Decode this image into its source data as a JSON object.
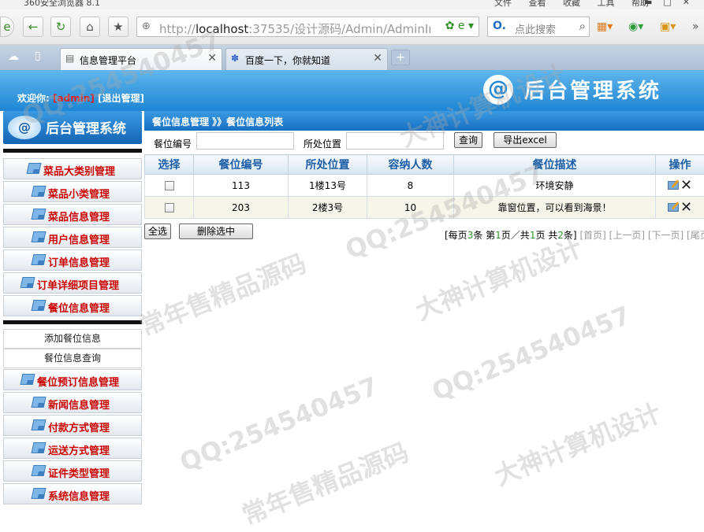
{
  "browser": {
    "app_title": "360安全浏览器 8.1",
    "menus": [
      "文件",
      "查看",
      "收藏",
      "工具",
      "帮助"
    ],
    "url_host": "localhost",
    "url_rest": ":37535/设计源码/Admin/AdminIı",
    "search_placeholder": "点此搜索",
    "tabs": [
      {
        "label": "信息管理平台",
        "active": true
      },
      {
        "label": "百度一下，你就知道",
        "active": false
      }
    ],
    "new_tab": "+"
  },
  "header": {
    "welcome_prefix": "欢迎你:",
    "username": "[admin]",
    "logout": "[退出管理]",
    "system_name": "后台管理系统",
    "logo_mark": "@"
  },
  "sidebar": {
    "logo_text": "后台管理系统",
    "items_top": [
      "菜品大类别管理",
      "菜品小类管理",
      "菜品信息管理",
      "用户信息管理",
      "订单信息管理",
      "订单详细项目管理",
      "餐位信息管理"
    ],
    "submenu": [
      "添加餐位信息",
      "餐位信息查询"
    ],
    "items_bottom": [
      "餐位预订信息管理",
      "新闻信息管理",
      "付款方式管理",
      "运送方式管理",
      "证件类型管理",
      "系统信息管理"
    ]
  },
  "main": {
    "breadcrumb": "餐位信息管理 》》餐位信息列表",
    "filters": {
      "label_number": "餐位编号",
      "label_location": "所处位置",
      "query_button": "查询",
      "export_button": "导出excel"
    },
    "table": {
      "headers": [
        "选择",
        "餐位编号",
        "所处位置",
        "容纳人数",
        "餐位描述",
        "操作"
      ],
      "rows": [
        {
          "number": "113",
          "location": "1楼13号",
          "capacity": "8",
          "description": "环境安静"
        },
        {
          "number": "203",
          "location": "2楼3号",
          "capacity": "10",
          "description": "靠窗位置，可以看到海景！"
        }
      ]
    },
    "actions": {
      "select_all": "全选",
      "delete_selected": "删除选中"
    },
    "pager": {
      "p1": "[每页",
      "per_page": "3",
      "p2": "条 第",
      "current": "1",
      "p3": "页／共",
      "pages": "1",
      "p4": "页 共",
      "total": "2",
      "p5": "条]",
      "first": "[首页]",
      "prev": "[上一页]",
      "next": "[下一页]",
      "last": "[尾页]"
    }
  },
  "watermarks": [
    "QQ:254540457",
    "大神计算机设计",
    "常年售精品源码"
  ]
}
